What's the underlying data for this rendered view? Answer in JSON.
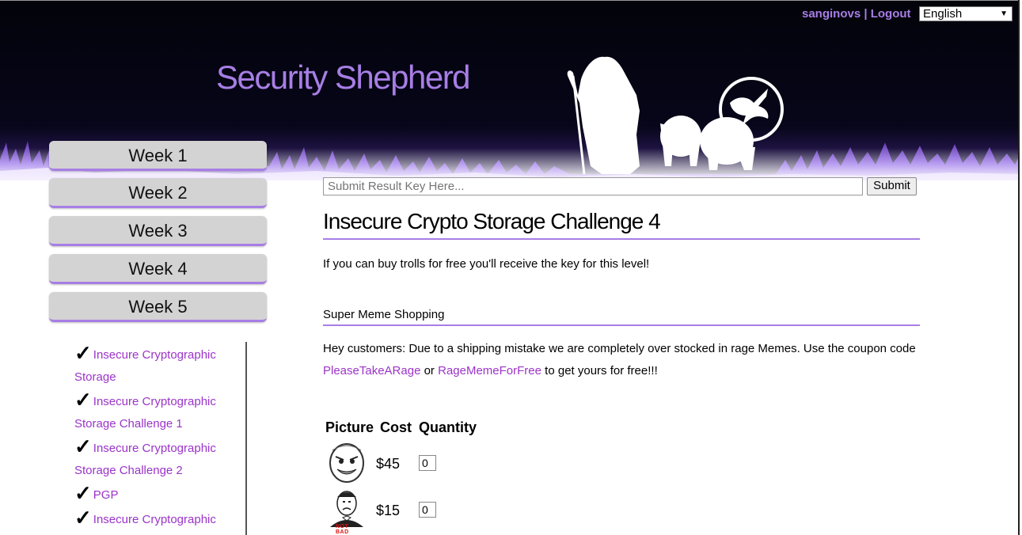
{
  "header": {
    "site_title": "Security Shepherd",
    "username": "sanginovs",
    "separator": "|",
    "logout_label": "Logout",
    "language_selected": "English",
    "accent_color": "#a77ee5"
  },
  "sidebar": {
    "weeks": [
      {
        "label": "Week 1"
      },
      {
        "label": "Week 2"
      },
      {
        "label": "Week 3"
      },
      {
        "label": "Week 4"
      },
      {
        "label": "Week 5"
      }
    ],
    "levels": [
      {
        "check": "✓",
        "line1": "Insecure Cryptographic",
        "line2": "Storage"
      },
      {
        "check": "✓",
        "line1": "Insecure Cryptographic",
        "line2": "Storage Challenge 1"
      },
      {
        "check": "✓",
        "line1": "Insecure Cryptographic",
        "line2": "Storage Challenge 2"
      },
      {
        "check": "✓",
        "line1": "PGP",
        "line2": ""
      },
      {
        "check": "✓",
        "line1": "Insecure Cryptographic",
        "line2": ""
      }
    ]
  },
  "main": {
    "result_key_placeholder": "Submit Result Key Here...",
    "submit_label": "Submit",
    "challenge_title": "Insecure Crypto Storage Challenge 4",
    "intro": "If you can buy trolls for free you'll receive the key for this level!",
    "shop_title": "Super Meme Shopping",
    "notice_prefix": "Hey customers: Due to a shipping mistake we are completely over stocked in rage Memes. Use the coupon code",
    "coupon1": "PleaseTakeARage",
    "notice_or": "or",
    "coupon2": "RageMemeForFree",
    "notice_suffix": "to get yours for free!!!",
    "table": {
      "headers": [
        "Picture",
        "Cost",
        "Quantity"
      ],
      "rows": [
        {
          "picture_icon": "rage-face-icon",
          "cost": "$45",
          "quantity": "0"
        },
        {
          "picture_icon": "not-bad-face-icon",
          "picture_caption": "NOT BAD",
          "cost": "$15",
          "quantity": "0"
        }
      ]
    }
  }
}
